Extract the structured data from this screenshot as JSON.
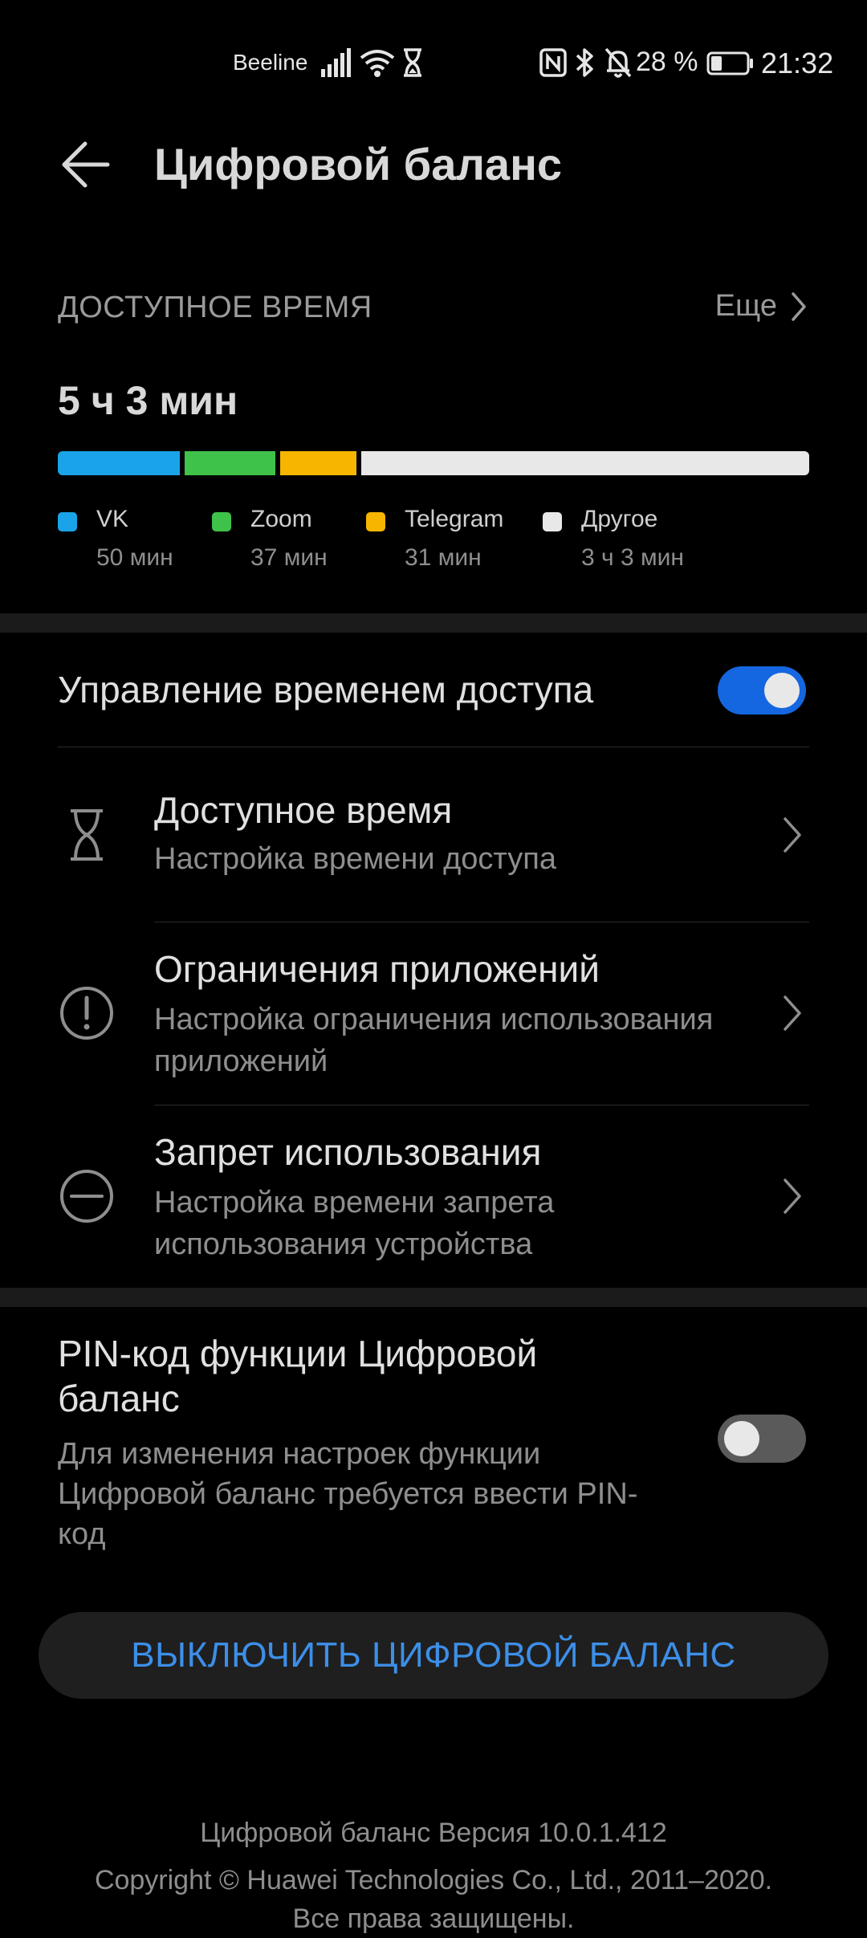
{
  "status_bar": {
    "carrier": "Beeline",
    "battery_percent": "28 %",
    "time": "21:32",
    "icons": [
      "signal-icon",
      "wifi-icon",
      "hourglass-icon",
      "nfc-icon",
      "bluetooth-icon",
      "mute-bell-icon",
      "battery-icon"
    ]
  },
  "header": {
    "title": "Цифровой баланс",
    "back_icon": "arrow-left-icon"
  },
  "usage": {
    "section_label": "ДОСТУПНОЕ ВРЕМЯ",
    "more_label": "Еще",
    "total": "5 ч 3 мин",
    "apps": [
      {
        "name": "VK",
        "time": "50 мин",
        "minutes": 50,
        "color": "#1aa3e8"
      },
      {
        "name": "Zoom",
        "time": "37 мин",
        "minutes": 37,
        "color": "#3fc24a"
      },
      {
        "name": "Telegram",
        "time": "31 мин",
        "minutes": 31,
        "color": "#f7b500"
      },
      {
        "name": "Другое",
        "time": "3 ч 3 мин",
        "minutes": 183,
        "color": "#e8e8e8"
      }
    ]
  },
  "access_control": {
    "label": "Управление временем доступа",
    "enabled": true,
    "toggle_on_color": "#1467e0",
    "items": [
      {
        "icon": "hourglass-icon",
        "title": "Доступное время",
        "subtitle": "Настройка времени доступа"
      },
      {
        "icon": "exclamation-circle-icon",
        "title": "Ограничения приложений",
        "subtitle": "Настройка ограничения использования приложений"
      },
      {
        "icon": "minus-circle-icon",
        "title": "Запрет использования",
        "subtitle": "Настройка времени запрета использования устройства"
      }
    ]
  },
  "pin": {
    "title": "PIN-код функции Цифровой баланс",
    "description": "Для изменения настроек функции Цифровой баланс требуется ввести PIN-код",
    "enabled": false
  },
  "disable_button": {
    "label": "ВЫКЛЮЧИТЬ ЦИФРОВОЙ БАЛАНС",
    "color": "#3d8fe8"
  },
  "footer": {
    "version": "Цифровой баланс Версия 10.0.1.412",
    "copyright": "Copyright © Huawei Technologies Co., Ltd., 2011–2020.",
    "rights": "Все права защищены."
  }
}
